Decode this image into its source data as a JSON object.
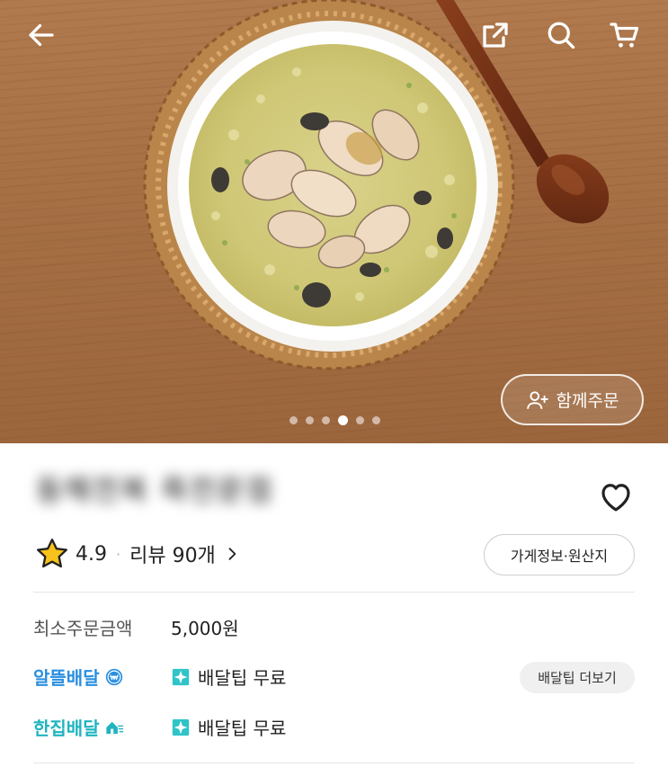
{
  "hero": {
    "group_order_label": "함께주문",
    "carousel": {
      "count": 6,
      "active_index": 3
    }
  },
  "store": {
    "name": "동해전복 죽전문점",
    "rating": "4.9",
    "reviews_label": "리뷰 90개",
    "info_button_label": "가게정보·원산지"
  },
  "order": {
    "min_order_label": "최소주문금액",
    "min_order_value": "5,000원"
  },
  "delivery": [
    {
      "type_label": "알뜰배달",
      "tip_label": "배달팁 무료",
      "brand_color": "#2a8fe0"
    },
    {
      "type_label": "한집배달",
      "tip_label": "배달팁 무료",
      "brand_color": "#1fb4c0"
    }
  ],
  "more_tips_label": "배달팁 더보기",
  "icons": [
    "back-arrow-icon",
    "share-icon",
    "search-icon",
    "cart-icon",
    "add-person-icon",
    "heart-icon",
    "star-icon",
    "chevron-right-icon",
    "coin-icon",
    "home-fast-icon",
    "sparkle-badge-icon"
  ]
}
